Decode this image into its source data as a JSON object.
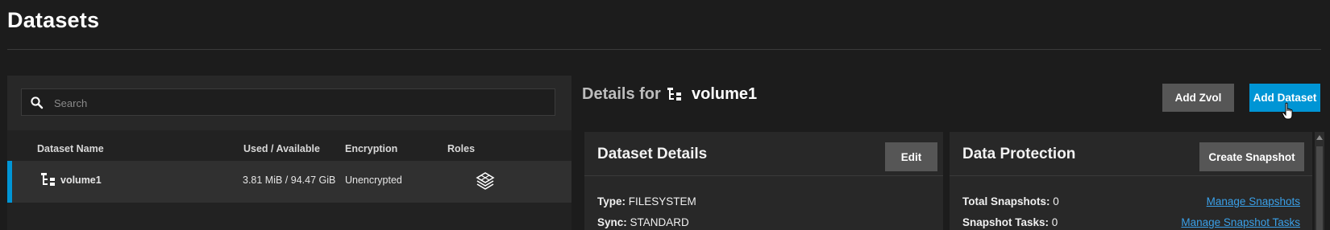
{
  "page": {
    "title": "Datasets"
  },
  "search": {
    "placeholder": "Search",
    "value": ""
  },
  "table": {
    "columns": [
      "Dataset Name",
      "Used / Available",
      "Encryption",
      "Roles"
    ],
    "rows": [
      {
        "name": "volume1",
        "used_available": "3.81 MiB / 94.47 GiB",
        "encryption": "Unencrypted",
        "roles_icon": "dataset-roles-icon",
        "selected": true
      }
    ]
  },
  "details": {
    "prefix": "Details for",
    "name": "volume1",
    "buttons": {
      "add_zvol": "Add Zvol",
      "add_dataset": "Add Dataset"
    }
  },
  "dataset_details": {
    "title": "Dataset Details",
    "edit_label": "Edit",
    "fields": [
      {
        "label": "Type:",
        "value": "FILESYSTEM"
      },
      {
        "label": "Sync:",
        "value": "STANDARD"
      }
    ]
  },
  "data_protection": {
    "title": "Data Protection",
    "create_label": "Create Snapshot",
    "fields": [
      {
        "label": "Total Snapshots:",
        "value": "0",
        "link": "Manage Snapshots"
      },
      {
        "label": "Snapshot Tasks:",
        "value": "0",
        "link": "Manage Snapshot Tasks"
      }
    ]
  },
  "colors": {
    "accent": "#0095d5",
    "background": "#1c1c1c",
    "panel": "#282828",
    "link": "#3aa0e8"
  }
}
